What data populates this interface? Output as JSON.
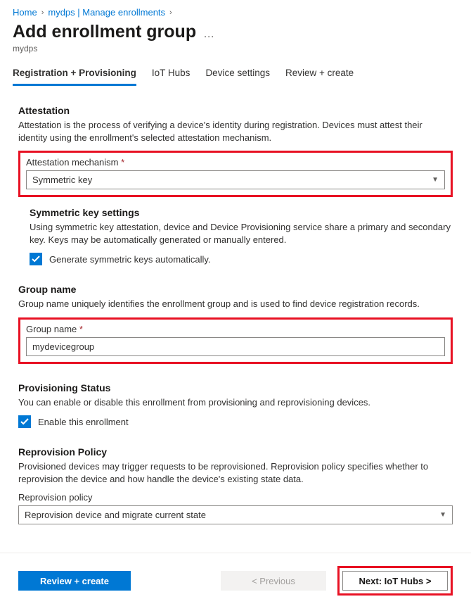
{
  "breadcrumb": {
    "home": "Home",
    "link2": "mydps | Manage enrollments"
  },
  "header": {
    "title": "Add enrollment group",
    "subtitle": "mydps",
    "ellipsis": "…"
  },
  "tabs": {
    "t1": "Registration + Provisioning",
    "t2": "IoT Hubs",
    "t3": "Device settings",
    "t4": "Review + create"
  },
  "attestation": {
    "title": "Attestation",
    "desc": "Attestation is the process of verifying a device's identity during registration. Devices must attest their identity using the enrollment's selected attestation mechanism.",
    "field_label": "Attestation mechanism",
    "value": "Symmetric key"
  },
  "symkey": {
    "title": "Symmetric key settings",
    "desc": "Using symmetric key attestation, device and Device Provisioning service share a primary and secondary key. Keys may be automatically generated or manually entered.",
    "checkbox_label": "Generate symmetric keys automatically."
  },
  "groupname": {
    "title": "Group name",
    "desc": "Group name uniquely identifies the enrollment group and is used to find device registration records.",
    "field_label": "Group name",
    "value": "mydevicegroup"
  },
  "provstatus": {
    "title": "Provisioning Status",
    "desc": "You can enable or disable this enrollment from provisioning and reprovisioning devices.",
    "checkbox_label": "Enable this enrollment"
  },
  "reprov": {
    "title": "Reprovision Policy",
    "desc": "Provisioned devices may trigger requests to be reprovisioned. Reprovision policy specifies whether to reprovision the device and how handle the device's existing state data.",
    "field_label": "Reprovision policy",
    "value": "Reprovision device and migrate current state"
  },
  "footer": {
    "review": "Review + create",
    "prev": "< Previous",
    "next": "Next: IoT Hubs >"
  }
}
